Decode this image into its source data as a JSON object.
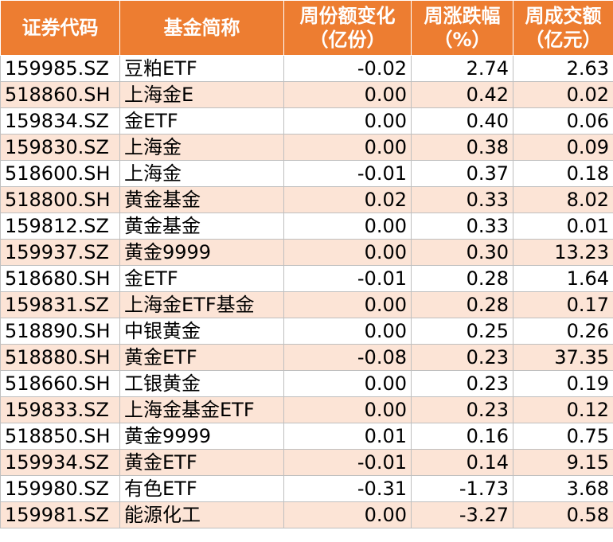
{
  "headers": [
    {
      "line1": "证券代码",
      "line2": ""
    },
    {
      "line1": "基金简称",
      "line2": ""
    },
    {
      "line1": "周份额变化",
      "line2": "（亿份）"
    },
    {
      "line1": "周涨跌幅",
      "line2": "（%）"
    },
    {
      "line1": "周成交额",
      "line2": "（亿元）"
    }
  ],
  "rows": [
    {
      "code": "159985.SZ",
      "name": "豆粕ETF",
      "share_change": "-0.02",
      "pct_change": "2.74",
      "turnover": "2.63"
    },
    {
      "code": "518860.SH",
      "name": "上海金E",
      "share_change": "0.00",
      "pct_change": "0.42",
      "turnover": "0.02"
    },
    {
      "code": "159834.SZ",
      "name": "金ETF",
      "share_change": "0.00",
      "pct_change": "0.40",
      "turnover": "0.06"
    },
    {
      "code": "159830.SZ",
      "name": "上海金",
      "share_change": "0.00",
      "pct_change": "0.38",
      "turnover": "0.09"
    },
    {
      "code": "518600.SH",
      "name": "上海金",
      "share_change": "-0.01",
      "pct_change": "0.37",
      "turnover": "0.18"
    },
    {
      "code": "518800.SH",
      "name": "黄金基金",
      "share_change": "0.02",
      "pct_change": "0.33",
      "turnover": "8.02"
    },
    {
      "code": "159812.SZ",
      "name": "黄金基金",
      "share_change": "0.00",
      "pct_change": "0.33",
      "turnover": "0.01"
    },
    {
      "code": "159937.SZ",
      "name": "黄金9999",
      "share_change": "0.00",
      "pct_change": "0.30",
      "turnover": "13.23"
    },
    {
      "code": "518680.SH",
      "name": "金ETF",
      "share_change": "-0.01",
      "pct_change": "0.28",
      "turnover": "1.64"
    },
    {
      "code": "159831.SZ",
      "name": "上海金ETF基金",
      "share_change": "0.00",
      "pct_change": "0.28",
      "turnover": "0.17"
    },
    {
      "code": "518890.SH",
      "name": "中银黄金",
      "share_change": "0.00",
      "pct_change": "0.25",
      "turnover": "0.26"
    },
    {
      "code": "518880.SH",
      "name": "黄金ETF",
      "share_change": "-0.08",
      "pct_change": "0.23",
      "turnover": "37.35"
    },
    {
      "code": "518660.SH",
      "name": "工银黄金",
      "share_change": "0.00",
      "pct_change": "0.23",
      "turnover": "0.19"
    },
    {
      "code": "159833.SZ",
      "name": "上海金基金ETF",
      "share_change": "0.00",
      "pct_change": "0.23",
      "turnover": "0.12"
    },
    {
      "code": "518850.SH",
      "name": "黄金9999",
      "share_change": "0.01",
      "pct_change": "0.16",
      "turnover": "0.75"
    },
    {
      "code": "159934.SZ",
      "name": "黄金ETF",
      "share_change": "-0.01",
      "pct_change": "0.14",
      "turnover": "9.15"
    },
    {
      "code": "159980.SZ",
      "name": "有色ETF",
      "share_change": "-0.31",
      "pct_change": "-1.73",
      "turnover": "3.68"
    },
    {
      "code": "159981.SZ",
      "name": "能源化工",
      "share_change": "0.00",
      "pct_change": "-3.27",
      "turnover": "0.58"
    }
  ],
  "colors": {
    "header_bg": "#ED7D31",
    "stripe_bg": "#FCE4D6",
    "border": "#BFBFBF"
  }
}
